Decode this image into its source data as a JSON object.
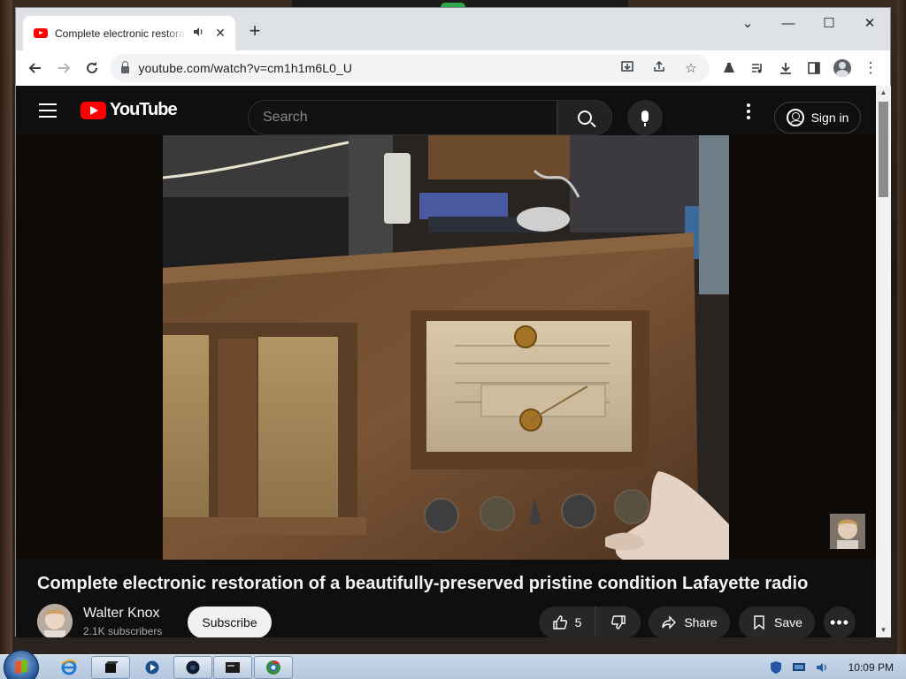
{
  "browser": {
    "tab_title": "Complete electronic restoration of a beautifully-preserved pristine condition Lafayette radio - YouTube",
    "tab_audio_icon": "speaker-icon",
    "new_tab_icon": "plus-icon",
    "url": "youtube.com/watch?v=cm1h1m6L0_U",
    "window_controls": {
      "collapse": "⌄",
      "minimize": "—",
      "maximize": "☐",
      "close": "✕"
    },
    "toolbar_icons": [
      "back-icon",
      "forward-icon",
      "reload-icon",
      "lock-icon",
      "install-icon",
      "share-icon",
      "bookmark-star-icon",
      "extensions-icon",
      "media-queue-icon",
      "download-icon",
      "side-panel-icon",
      "profile-icon",
      "menu-icon"
    ]
  },
  "youtube": {
    "logo_text": "YouTube",
    "search_placeholder": "Search",
    "sign_in_label": "Sign in",
    "video": {
      "title": "Complete electronic restoration of a beautifully-preserved pristine condition Lafayette radio",
      "channel_name": "Walter Knox",
      "subscribers": "2.1K subscribers",
      "subscribe_label": "Subscribe",
      "like_count": "5",
      "share_label": "Share",
      "save_label": "Save",
      "more_label": "•••"
    }
  },
  "taskbar": {
    "clock": "10:09 PM",
    "pinned_icons": [
      "internet-explorer-icon",
      "terminal-icon",
      "media-player-icon",
      "app-icon",
      "console-icon",
      "chrome-icon"
    ]
  },
  "colors": {
    "yt_red": "#ff0000",
    "yt_bg": "#0f0f0f",
    "chrome_frame": "#dee1e6"
  }
}
